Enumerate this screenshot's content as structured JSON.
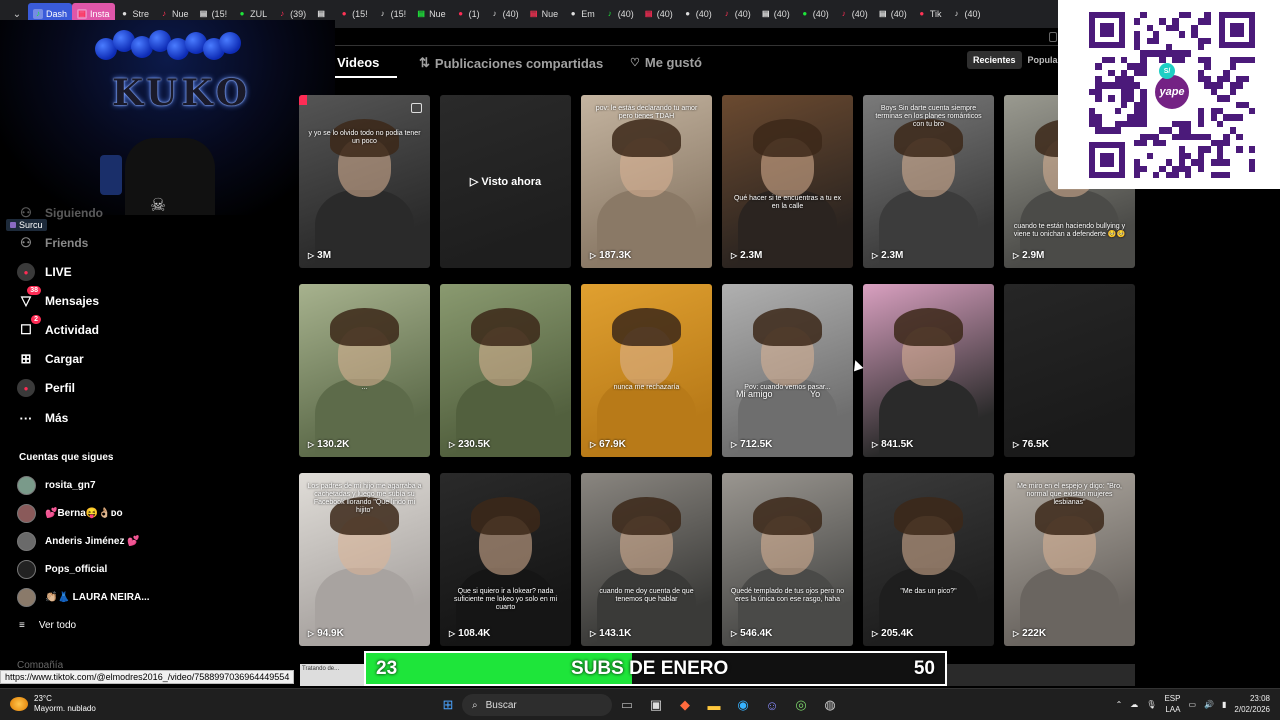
{
  "browser": {
    "tabs": [
      {
        "label": "Dash",
        "style": "blue"
      },
      {
        "label": "Insta",
        "style": "pink"
      },
      {
        "label": "Stre",
        "style": "plain"
      },
      {
        "label": "Nue",
        "style": "plain"
      },
      {
        "label": "(15!",
        "style": "plain"
      },
      {
        "label": "ZUL",
        "style": "plain"
      },
      {
        "label": "(39)",
        "style": "plain"
      },
      {
        "label": "",
        "style": "plain"
      },
      {
        "label": "(15!",
        "style": "plain"
      },
      {
        "label": "(15!",
        "style": "plain"
      },
      {
        "label": "Nue",
        "style": "plain"
      },
      {
        "label": "(1)",
        "style": "plain"
      },
      {
        "label": "(40)",
        "style": "plain"
      },
      {
        "label": "Nue",
        "style": "plain"
      },
      {
        "label": "Em",
        "style": "plain"
      },
      {
        "label": "(40)",
        "style": "plain"
      },
      {
        "label": "(40)",
        "style": "plain"
      },
      {
        "label": "(40)",
        "style": "plain"
      },
      {
        "label": "(40)",
        "style": "plain"
      },
      {
        "label": "(40)",
        "style": "plain"
      },
      {
        "label": "(40)",
        "style": "plain"
      },
      {
        "label": "(40)",
        "style": "plain"
      },
      {
        "label": "(40)",
        "style": "plain"
      },
      {
        "label": "Tik",
        "style": "plain"
      },
      {
        "label": "(40)",
        "style": "plain"
      }
    ]
  },
  "webcam": {
    "label": "Surcu",
    "sign": "KUKO"
  },
  "sidebar": {
    "items": [
      {
        "label": "Siguiendo",
        "icon": "following-icon",
        "badge": ""
      },
      {
        "label": "Friends",
        "icon": "friends-icon",
        "badge": ""
      },
      {
        "label": "LIVE",
        "icon": "live-icon",
        "badge": ""
      },
      {
        "label": "Mensajes",
        "icon": "messages-icon",
        "badge": "38"
      },
      {
        "label": "Actividad",
        "icon": "activity-icon",
        "badge": "2"
      },
      {
        "label": "Cargar",
        "icon": "upload-icon",
        "badge": ""
      },
      {
        "label": "Perfil",
        "icon": "profile-icon",
        "badge": ""
      },
      {
        "label": "Más",
        "icon": "more-icon",
        "badge": ""
      }
    ],
    "following_header": "Cuentas que sigues",
    "following": [
      {
        "name": "rosita_gn7"
      },
      {
        "name": "💕Berna😝👌🏼ᴅᴏ"
      },
      {
        "name": "Anderis Jiménez 💕"
      },
      {
        "name": "Pops_official"
      },
      {
        "name": "👏🏼👗 LAURA NEIRA..."
      }
    ],
    "see_all": "Ver todo",
    "company": "Compañía"
  },
  "profile_tabs": {
    "videos": "Videos",
    "reposts": "Publicaciones compartidas",
    "liked": "Me gustó",
    "sort_recent": "Recientes",
    "sort_popular": "Popular"
  },
  "videos": [
    {
      "views": "3M",
      "caption": "y yo se lo olvido todo no podia tener un poco",
      "watched": "",
      "colors": [
        "#2a2a2a",
        "#555"
      ]
    },
    {
      "views": "",
      "caption": "",
      "watched": "▷ Visto ahora",
      "colors": [
        "#1e1e1e",
        "#2a2a2a"
      ]
    },
    {
      "views": "187.3K",
      "caption": "pov: le estás declarando tu amor pero tienes TDAH",
      "watched": "",
      "colors": [
        "#8a7966",
        "#c4b4a0"
      ]
    },
    {
      "views": "2.3M",
      "caption": "Qué hacer si te encuentras a tu ex en la calle",
      "watched": "",
      "colors": [
        "#2b2420",
        "#6b4a30"
      ]
    },
    {
      "views": "2.3M",
      "caption": "Boys Sin darte cuenta siempre terminas en los planes románticos con tu bro",
      "watched": "",
      "colors": [
        "#3c3c3c",
        "#7a7a7a"
      ]
    },
    {
      "views": "2.9M",
      "caption": "cuando te están haciendo bullying y viene tu onichan a defenderte 🥺🥺",
      "watched": "",
      "colors": [
        "#4b4b48",
        "#9a9a90"
      ]
    },
    {
      "views": "130.2K",
      "caption": "...",
      "watched": "",
      "colors": [
        "#5d6b4a",
        "#a7b28e"
      ]
    },
    {
      "views": "230.5K",
      "caption": "",
      "watched": "",
      "colors": [
        "#52603e",
        "#8a9a70"
      ]
    },
    {
      "views": "67.9K",
      "caption": "nunca me rechazaría",
      "watched": "",
      "colors": [
        "#b87a18",
        "#e0a030"
      ]
    },
    {
      "views": "712.5K",
      "caption": "Pov: cuando vemos pasar...",
      "watched": "",
      "colors": [
        "#6e6e6e",
        "#b0b0b0"
      ],
      "labels": [
        "Mi amigo",
        "Yo"
      ]
    },
    {
      "views": "841.5K",
      "caption": "",
      "watched": "",
      "colors": [
        "#2a2a2a",
        "#d9a0c0"
      ]
    },
    {
      "views": "76.5K",
      "caption": "",
      "watched": "",
      "colors": [
        "#1a1a1a",
        "#262626"
      ]
    },
    {
      "views": "94.9K",
      "caption": "Los padres de mi hijo me agarraba a cachetadas y luego me subía su Facebook llorando \"Que lindo mi hijito\"",
      "watched": "",
      "colors": [
        "#a8a3a0",
        "#e0ddd8"
      ]
    },
    {
      "views": "108.4K",
      "caption": "Que si quiero ir a lokear? nada suficiente me lokeo yo solo en mi cuarto",
      "watched": "",
      "colors": [
        "#151515",
        "#2a2a2a"
      ]
    },
    {
      "views": "143.1K",
      "caption": "cuando me doy cuenta de que tenemos que hablar",
      "watched": "",
      "colors": [
        "#3a3a38",
        "#8a8680"
      ]
    },
    {
      "views": "546.4K",
      "caption": "Quedé templado de tus ojos pero no eres la única con ese rasgo, haha",
      "watched": "",
      "colors": [
        "#4a4a48",
        "#9a9690"
      ]
    },
    {
      "views": "205.4K",
      "caption": "\"Me das un pico?\"",
      "watched": "",
      "colors": [
        "#1e1e1e",
        "#3a3a3a"
      ]
    },
    {
      "views": "222K",
      "caption": "Me miro en el espejo y digo: \"Bro, normal que existan mujeres lesbianas\"",
      "watched": "",
      "colors": [
        "#6a6560",
        "#b0aaa2"
      ]
    }
  ],
  "subs_bar": {
    "current": "23",
    "label": "SUBS DE ENERO",
    "goal": "50",
    "progress": 0.46
  },
  "status_url": "https://www.tiktok.com/@elmodres2016_/video/7588997036964449554",
  "bottom_caption": "Tratando de...",
  "taskbar": {
    "weather_temp": "23°C",
    "weather_desc": "Mayorm. nublado",
    "search": "Buscar",
    "lang": "ESP",
    "lang2": "LAA",
    "time": "23:08",
    "date": "2/02/2026"
  },
  "qr": {
    "brand": "yape",
    "badge": "S/"
  },
  "colors": {
    "accent": "#fe2c55",
    "progress": "#1ee53a",
    "yape": "#742284"
  }
}
